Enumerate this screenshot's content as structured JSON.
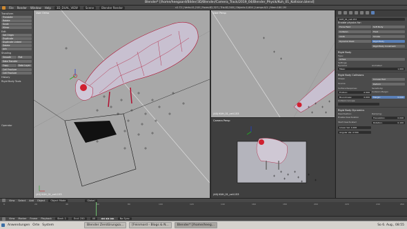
{
  "window": {
    "title": "Blender* [/home/heegaard/Bilder/3D/Blender/Camera_Track/2019_04/Blender_Physik/Kuh_01_Kollision.blend]"
  },
  "topbar": {
    "menus": [
      "File",
      "Render",
      "Window",
      "Help"
    ],
    "layout": "3D_DUAL_VIEW",
    "scene": "Scene",
    "engine": "Blender Render",
    "stats": "v2.72 | Verts:41,218 | Faces:82,327 | Tris:82,348 | Objects:1/404 | Lamps:0/1 | Mem:180.1M"
  },
  "tool_panel": {
    "transform_title": "Transform",
    "transform_buttons": [
      "Translate",
      "Rotate",
      "Scale",
      "Mirror"
    ],
    "edit_title": "Edit",
    "origin_button": "Set Origin",
    "edit_buttons": [
      "Duplicate",
      "Duplicate Linked",
      "Delete",
      "Join"
    ],
    "shading_title": "Shading",
    "shading_buttons": [
      "Smooth",
      "Flat"
    ],
    "data_transfer": "Data Transfer",
    "link_buttons": [
      "Copy",
      "Data Layer"
    ],
    "fracture_buttons": [
      "Cell Fracture",
      "Cell Fracture"
    ],
    "history_title": "History",
    "rigid_title": "Rigid Body Tools",
    "operator_title": "Operator"
  },
  "viewport_main": {
    "label": "User Ortho",
    "object": "(40) KUH_01_cell.153"
  },
  "viewport_top_right": {
    "label": "User Persp",
    "object": "(40) KUH_01_cell.153"
  },
  "viewport_bottom_right": {
    "label": "Camera Persp",
    "object": "(40) KUH_01_cell.153"
  },
  "properties": {
    "object_name": "KUH_01_cell.153",
    "physics_title": "Enable physics for:",
    "physics_buttons": [
      "Force Field",
      "Soft Body",
      "Collision",
      "Fluid",
      "Cloth",
      "Smoke",
      "Dynamic Paint",
      "Rigid Body",
      "Rigid Body Constraint"
    ],
    "rigidbody_title": "Rigid Body",
    "type_label": "Type:",
    "type_value": "Active",
    "settings_title": "Settings:",
    "dynamic_label": "Dynamic",
    "animated_label": "Animated",
    "mass_label": "Mass:",
    "mass_value": "1.000",
    "collisions_title": "Rigid Body Collisions",
    "shape_label": "Shape:",
    "shape_value": "Convex Hull",
    "source_label": "Source:",
    "source_value": "Deform",
    "surface_label": "Surface Response:",
    "sensitivity_label": "Sensitivity:",
    "friction_label": "Friction:",
    "friction_value": "0.500",
    "collision_margin_label": "Collision Margin",
    "bounciness_label": "Bounciness:",
    "bounciness_value": "0.000",
    "margin_label": "Margin:",
    "margin_value": "0.040",
    "groups_label": "Collision Groups:",
    "dynamics_title": "Rigid Body Dynamics",
    "deactivation_label": "Deactivation:",
    "damping_label": "Damping:",
    "enable_deactivation": "Enable Deactivation",
    "start_deactivated": "Start Deactivated",
    "translation_label": "Translation:",
    "translation_value": "0.040",
    "rotation_label": "Rotation:",
    "rotation_value": "0.100",
    "linear_vel_label": "Linear Vel: 0.400",
    "angular_vel_label": "Angular Vel: 0.500"
  },
  "view_header": {
    "items": [
      "View",
      "Select",
      "Add",
      "Object"
    ],
    "mode": "Object Mode",
    "orientation": "Global"
  },
  "timeline": {
    "items": [
      "View",
      "Marker",
      "Frame",
      "Playback"
    ],
    "start": "Start: 1",
    "end": "End: 250",
    "current": "40",
    "sync": "No Sync",
    "ticks": [
      "0",
      "20",
      "40",
      "60",
      "80",
      "100",
      "120",
      "140",
      "160",
      "180",
      "200",
      "220",
      "240",
      "260"
    ]
  },
  "taskbar": {
    "items": [
      "Anwendungen",
      "Orte",
      "System"
    ],
    "tasks": [
      "Blender Zerstörungsa...",
      "[Feinmord - Blogs & N...",
      "Blender* [/home/heeg..."
    ],
    "clock": "So 6. Aug., 08:55"
  },
  "colors": {
    "accent": "#5a80b8",
    "viewport_bg": "#a8a8a8",
    "mesh_edge": "#b01030",
    "mesh_fill": "#c8c0d0"
  }
}
